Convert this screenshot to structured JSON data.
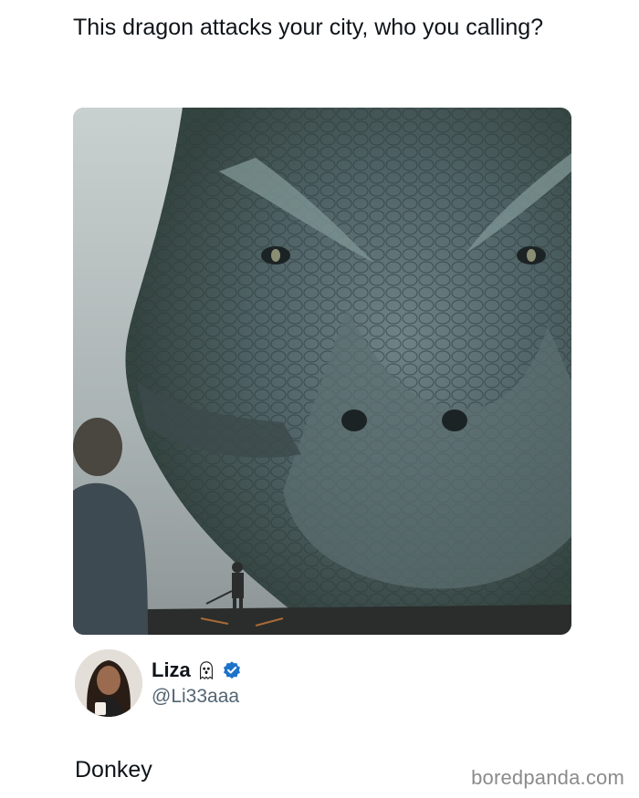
{
  "post": {
    "text": "This dragon attacks your city, who you calling?",
    "image_alt": "dragon-closeup-photo"
  },
  "author": {
    "display_name": "Liza",
    "handle": "@Li33aaa",
    "ghost_icon": "ghost-emoji-icon",
    "verified_icon": "verified-badge-icon",
    "verified_color": "#1d72c9"
  },
  "reply": {
    "text": "Donkey"
  },
  "watermark": {
    "text": "boredpanda.com"
  }
}
